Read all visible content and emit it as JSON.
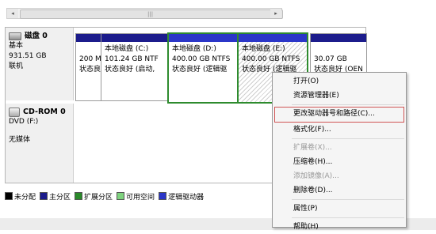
{
  "scrollbar": {
    "left_arrow": "◂",
    "right_arrow": "▸",
    "grip": "|||"
  },
  "disks": [
    {
      "name": "磁盘 0",
      "type": "基本",
      "size": "931.51 GB",
      "status": "联机"
    },
    {
      "name": "CD-ROM 0",
      "type": "DVD (F:)",
      "media": "无媒体"
    }
  ],
  "partitions": [
    {
      "line1": "",
      "line2": "200 M",
      "line3": "状态良好",
      "bar_color": "#1c1c8c"
    },
    {
      "line1": "本地磁盘 (C:)",
      "line2": "101.24 GB NTF",
      "line3": "状态良好 (启动,",
      "bar_color": "#1c1c8c"
    },
    {
      "line1": "本地磁盘 (D:)",
      "line2": "400.00 GB NTFS",
      "line3": "状态良好 (逻辑驱",
      "bar_color": "#2b36c8"
    },
    {
      "line1": "本地磁盘 (E:)",
      "line2": "400.00 GB NTFS",
      "line3": "状态良好 (逻辑驱",
      "bar_color": "#2b36c8"
    },
    {
      "line1": "",
      "line2": "30.07 GB",
      "line3": "状态良好 (OEN",
      "bar_color": "#1c1c8c"
    }
  ],
  "legend": [
    {
      "label": "未分配",
      "color": "#000000"
    },
    {
      "label": "主分区",
      "color": "#1c1c8c"
    },
    {
      "label": "扩展分区",
      "color": "#2a8a2a"
    },
    {
      "label": "可用空间",
      "color": "#7ed37e"
    },
    {
      "label": "逻辑驱动器",
      "color": "#2b36c8"
    }
  ],
  "context_menu": {
    "items": [
      {
        "label": "打开(O)",
        "enabled": true
      },
      {
        "label": "资源管理器(E)",
        "enabled": true
      },
      {
        "separator": true
      },
      {
        "label": "更改驱动器号和路径(C)...",
        "enabled": true,
        "highlighted": true
      },
      {
        "label": "格式化(F)...",
        "enabled": true
      },
      {
        "separator": true
      },
      {
        "label": "扩展卷(X)...",
        "enabled": false
      },
      {
        "label": "压缩卷(H)...",
        "enabled": true
      },
      {
        "label": "添加镜像(A)...",
        "enabled": false
      },
      {
        "label": "删除卷(D)...",
        "enabled": true
      },
      {
        "separator": true
      },
      {
        "label": "属性(P)",
        "enabled": true
      },
      {
        "separator": true
      },
      {
        "label": "帮助(H)",
        "enabled": true
      }
    ]
  }
}
